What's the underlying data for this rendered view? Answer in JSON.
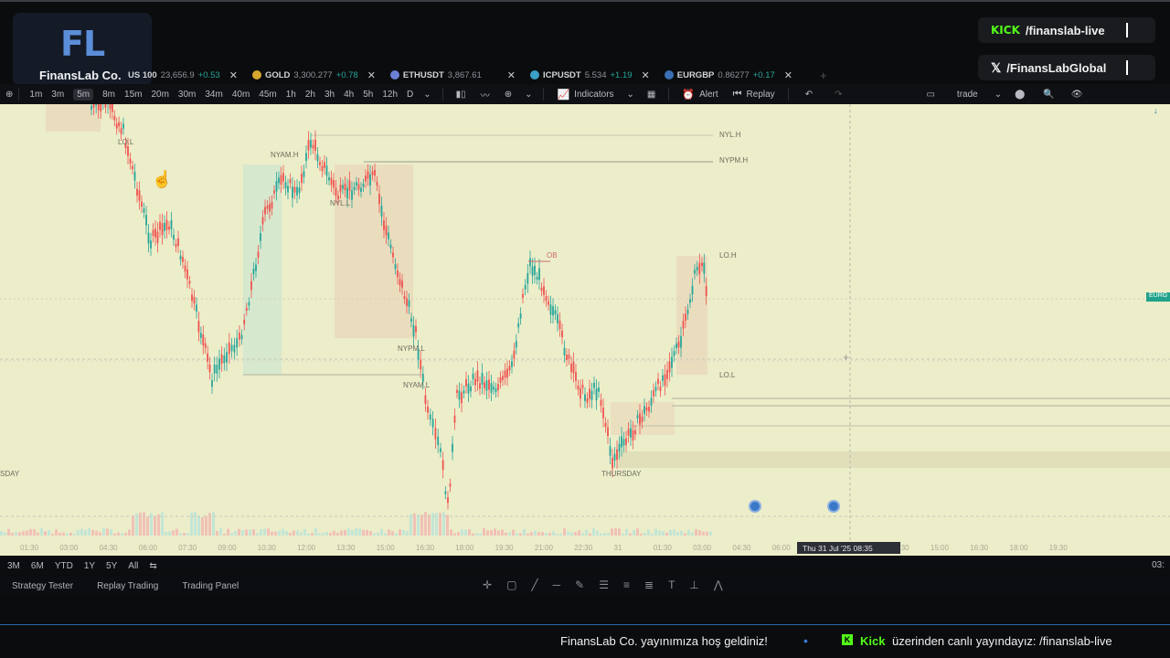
{
  "branding": {
    "logo_letters": "FL",
    "name": "FinansLab Co."
  },
  "social": {
    "kick_label": "KICK",
    "kick_handle": "/finanslab-live",
    "x_handle": "/FinansLabGlobal"
  },
  "symbol_tabs": [
    {
      "symbol": "US 100",
      "price": "23,656.9",
      "change": "+0.53",
      "icon_color": "#1e3a5f"
    },
    {
      "symbol": "GOLD",
      "price": "3,300.277",
      "change": "+0.78",
      "icon_color": "#d4a72c"
    },
    {
      "symbol": "ETHUSDT",
      "price": "3,867.61",
      "change": "-",
      "icon_color": "#6b7fd6"
    },
    {
      "symbol": "ICPUSDT",
      "price": "5.534",
      "change": "+1.19",
      "icon_color": "#3aa0c8"
    },
    {
      "symbol": "EURGBP",
      "price": "0.86277",
      "change": "+0.17",
      "icon_color": "#3b6fb6"
    }
  ],
  "toolbar": {
    "timeframes": [
      "1m",
      "3m",
      "5m",
      "8m",
      "15m",
      "20m",
      "30m",
      "34m",
      "40m",
      "45m",
      "1h",
      "2h",
      "3h",
      "4h",
      "5h",
      "12h",
      "D"
    ],
    "active_timeframe": "5m",
    "indicators_label": "Indicators",
    "alert_label": "Alert",
    "replay_label": "Replay",
    "trade_label": "trade"
  },
  "chart": {
    "level_labels": {
      "nyl_h": "NYL.H",
      "nypm_h": "NYPM.H",
      "nyam_h": "NYAM.H",
      "nyl_l": "NYL.L",
      "lo_l_left": "LO.L",
      "nypm_l": "NYPM.L",
      "nyam_l": "NYAM.L",
      "lo_h": "LO.H",
      "lo_l": "LO.L",
      "ob": "OB",
      "thursday": "THURSDAY",
      "wednesday": "SDAY"
    },
    "price_tag": "EURG",
    "time_ticks": [
      "01:30",
      "03:00",
      "04:30",
      "06:00",
      "07:30",
      "09:00",
      "10:30",
      "12:00",
      "13:30",
      "15:00",
      "16:30",
      "18:00",
      "19:30",
      "21:00",
      "22:30",
      "31",
      "01:30",
      "03:00",
      "04:30",
      "06:00",
      "20",
      "12:00",
      "13:30",
      "15:00",
      "16:30",
      "18:00",
      "19:30"
    ],
    "cursor_time": "Thu 31 Jul '25   08:35"
  },
  "ranges": {
    "items": [
      "3M",
      "6M",
      "YTD",
      "1Y",
      "5Y",
      "All"
    ],
    "clock": "03:"
  },
  "bottom_panel": {
    "tabs": [
      "Strategy Tester",
      "Replay Trading",
      "Trading Panel"
    ]
  },
  "ticker": {
    "welcome": "FinansLab Co. yayınımıza hoş geldiniz!",
    "kick_word": "Kick",
    "live_text": "üzerinden canlı yayındayız: /finanslab-live"
  }
}
